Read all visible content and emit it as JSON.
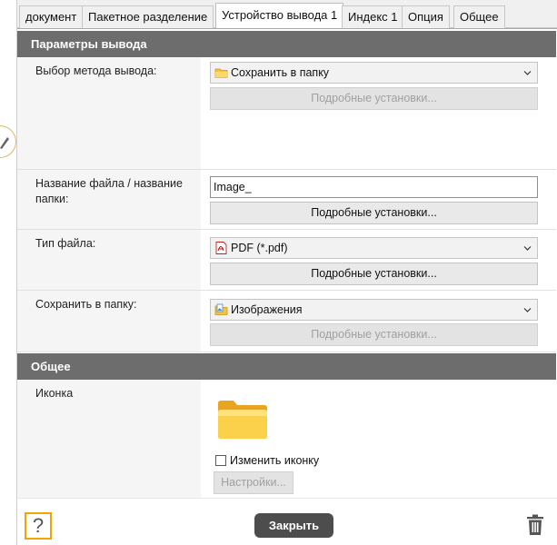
{
  "tabs": [
    {
      "label": "документ",
      "active": false
    },
    {
      "label": "Пакетное разделение",
      "active": false
    },
    {
      "label": "Устройство вывода 1",
      "active": true
    },
    {
      "label": "Индекс 1",
      "active": false
    },
    {
      "label": "Опция",
      "active": false
    },
    {
      "label": "Общее",
      "active": false
    }
  ],
  "output_params": {
    "header": "Параметры вывода",
    "method": {
      "label": "Выбор метода вывода:",
      "value": "Сохранить в папку",
      "icon": "folder-icon",
      "details_button": "Подробные установки...",
      "details_enabled": false
    },
    "filename": {
      "label": "Название файла / название папки:",
      "value": "Image_",
      "details_button": "Подробные установки...",
      "details_enabled": true
    },
    "filetype": {
      "label": "Тип файла:",
      "value": "PDF (*.pdf)",
      "icon": "pdf-icon",
      "details_button": "Подробные установки...",
      "details_enabled": true
    },
    "save_folder": {
      "label": "Сохранить в папку:",
      "value": "Изображения",
      "icon": "pictures-folder-icon",
      "details_button": "Подробные установки...",
      "details_enabled": false
    }
  },
  "general": {
    "header": "Общее",
    "icon_label": "Иконка",
    "icon": "folder-large-icon",
    "change_icon_label": "Изменить иконку",
    "change_icon_checked": false,
    "settings_button": "Настройки...",
    "settings_enabled": false
  },
  "footer": {
    "help_label": "?",
    "close_label": "Закрыть"
  },
  "colors": {
    "accent": "#f2a500",
    "header_bg": "#6d6d6d",
    "close_bg": "#4d4d4d"
  }
}
